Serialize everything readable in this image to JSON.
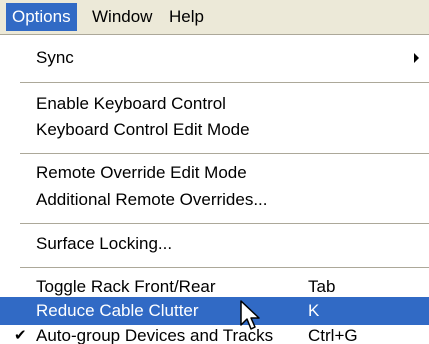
{
  "menubar": {
    "items": [
      {
        "label": "Options"
      },
      {
        "label": "Window"
      },
      {
        "label": "Help"
      }
    ]
  },
  "menu": {
    "items": [
      {
        "label": "Sync",
        "shortcut": "",
        "submenu": true
      },
      {
        "label": "Enable Keyboard Control",
        "shortcut": ""
      },
      {
        "label": "Keyboard Control Edit Mode",
        "shortcut": ""
      },
      {
        "label": "Remote Override Edit Mode",
        "shortcut": ""
      },
      {
        "label": "Additional Remote Overrides...",
        "shortcut": ""
      },
      {
        "label": "Surface Locking...",
        "shortcut": ""
      },
      {
        "label": "Toggle Rack Front/Rear",
        "shortcut": "Tab"
      },
      {
        "label": "Reduce Cable Clutter",
        "shortcut": "K",
        "highlighted": true
      },
      {
        "label": "Auto-group Devices and Tracks",
        "shortcut": "Ctrl+G",
        "checked": true
      }
    ]
  },
  "colors": {
    "highlight": "#316ac5",
    "menubar_bg": "#ece9d8",
    "separator": "#aca899"
  },
  "icons": {
    "check": "checkmark-icon",
    "submenu": "submenu-arrow-icon",
    "cursor": "mouse-pointer-icon"
  }
}
